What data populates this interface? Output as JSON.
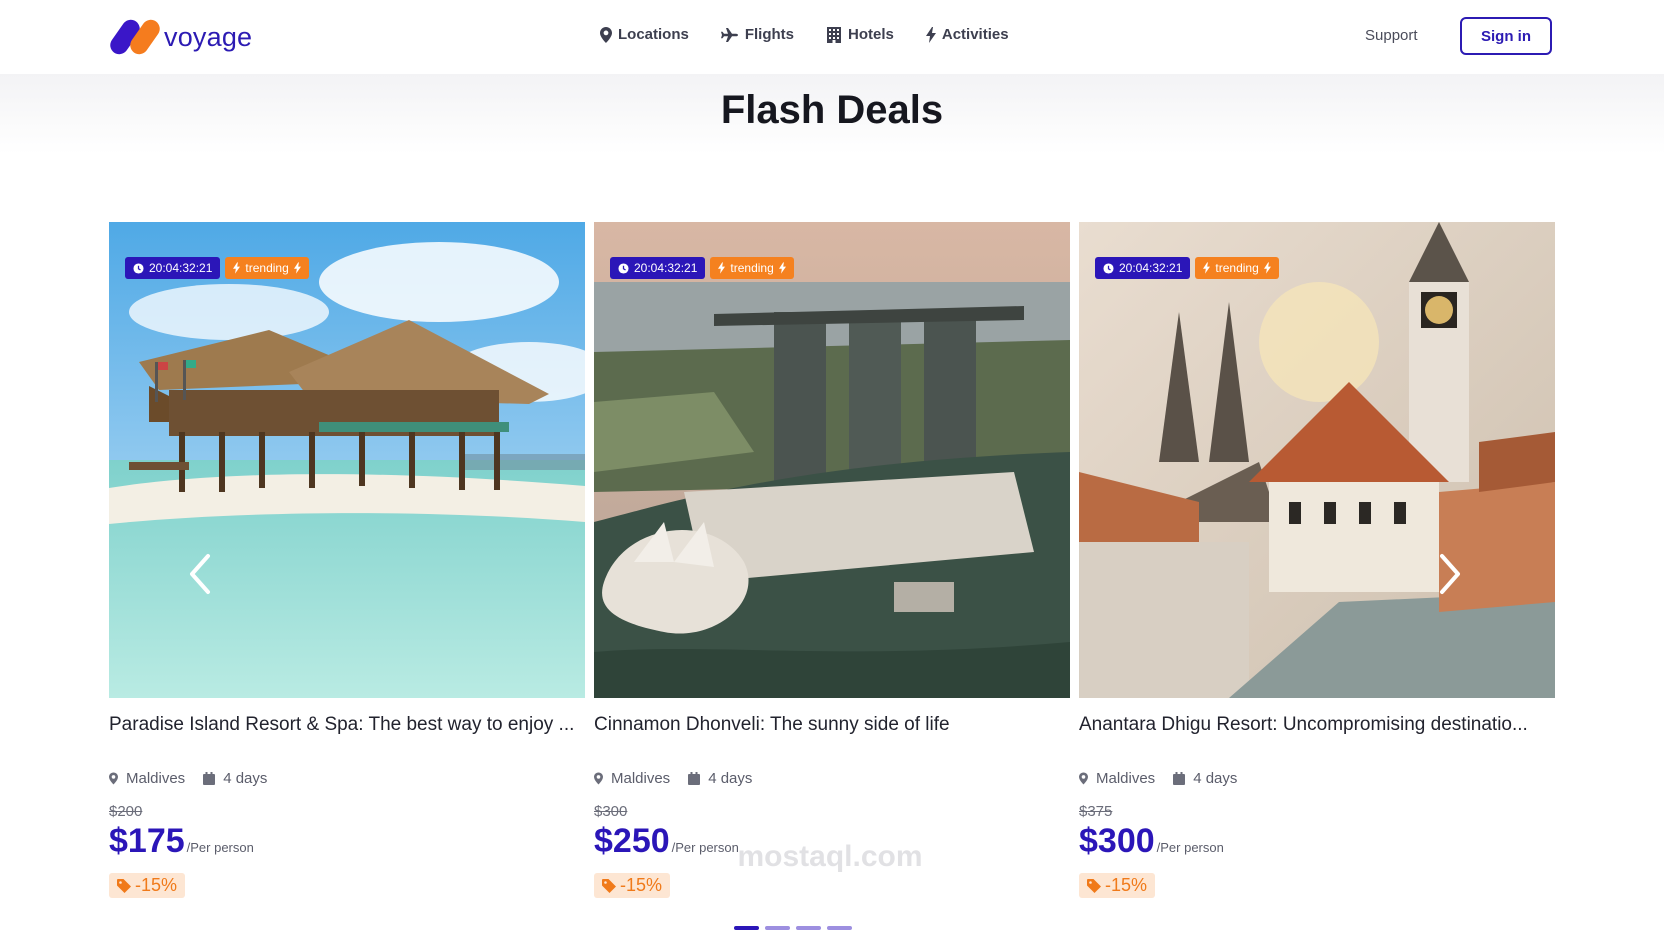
{
  "brand": {
    "name": "voyage"
  },
  "nav": [
    {
      "label": "Locations",
      "icon": "location-pin-icon"
    },
    {
      "label": "Flights",
      "icon": "plane-icon"
    },
    {
      "label": "Hotels",
      "icon": "building-icon"
    },
    {
      "label": "Activities",
      "icon": "bolt-icon"
    }
  ],
  "header": {
    "support_label": "Support",
    "signin_label": "Sign in"
  },
  "section": {
    "title": "Flash Deals"
  },
  "cards": [
    {
      "timer": "20:04:32:21",
      "badge": "trending",
      "title": "Paradise Island Resort & Spa: The best way to enjoy ...",
      "location": "Maldives",
      "duration": "4 days",
      "old_price": "$200",
      "price": "$175",
      "per": "/Per person",
      "discount": "-15%"
    },
    {
      "timer": "20:04:32:21",
      "badge": "trending",
      "title": "Cinnamon Dhonveli: The sunny side of life",
      "location": "Maldives",
      "duration": "4 days",
      "old_price": "$300",
      "price": "$250",
      "per": "/Per person",
      "discount": "-15%"
    },
    {
      "timer": "20:04:32:21",
      "badge": "trending",
      "title": "Anantara Dhigu Resort: Uncompromising destinatio...",
      "location": "Maldives",
      "duration": "4 days",
      "old_price": "$375",
      "price": "$300",
      "per": "/Per person",
      "discount": "-15%"
    }
  ],
  "carousel": {
    "pages": 4,
    "active_page": 1
  },
  "watermark": {
    "text": "mostaql.com"
  },
  "colors": {
    "primary": "#2b16b8",
    "accent": "#f5811f",
    "discount_bg": "#fde6d3"
  }
}
